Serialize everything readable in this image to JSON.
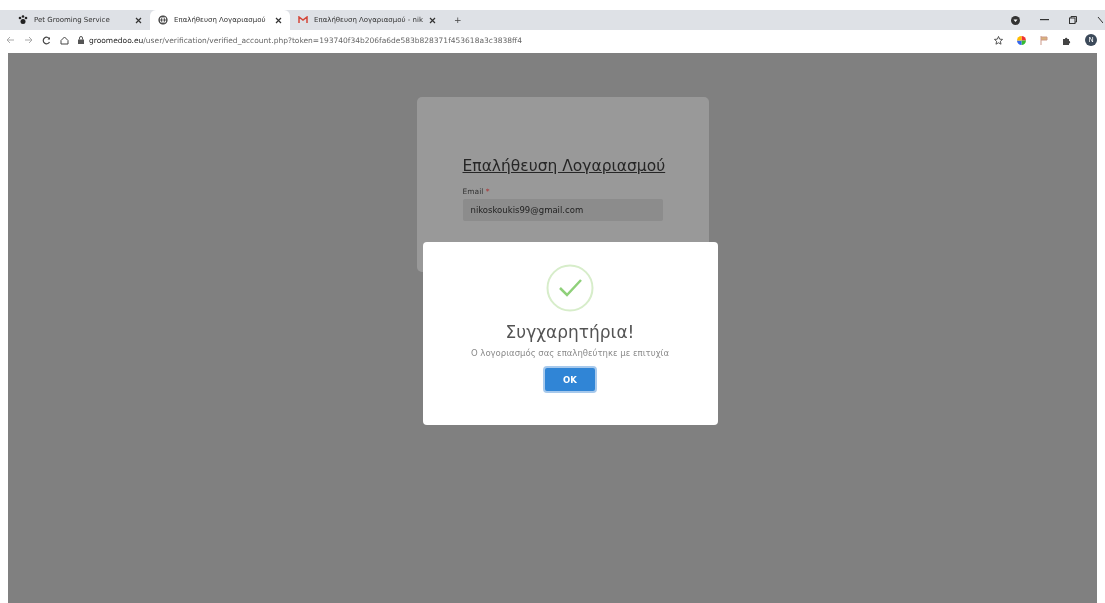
{
  "tabs": [
    {
      "title": "Pet Grooming Service",
      "selected": false,
      "kind": "paw"
    },
    {
      "title": "Επαλήθευση Λογαριασμού",
      "selected": true,
      "kind": "globe"
    },
    {
      "title": "Επαλήθευση Λογαριασμού - nik",
      "selected": false,
      "kind": "mail"
    }
  ],
  "new_tab": "+",
  "address": {
    "host": "groomedoo.eu",
    "path": "/user/verification/verified_account.php?token=193740f34b206fa6de583b828371f453618a3c3838ff4"
  },
  "profile_initial": "N",
  "card": {
    "title": "Επαλήθευση Λογαριασμού",
    "email_label": "Email",
    "required_mark": "*",
    "email_value": "nikoskoukis99@gmail.com"
  },
  "dialog": {
    "title": "Συγχαρητήρια!",
    "message": "Ο λογοριασμός σας επαληθεύτηκε με επιτυχία",
    "button": "OK"
  }
}
